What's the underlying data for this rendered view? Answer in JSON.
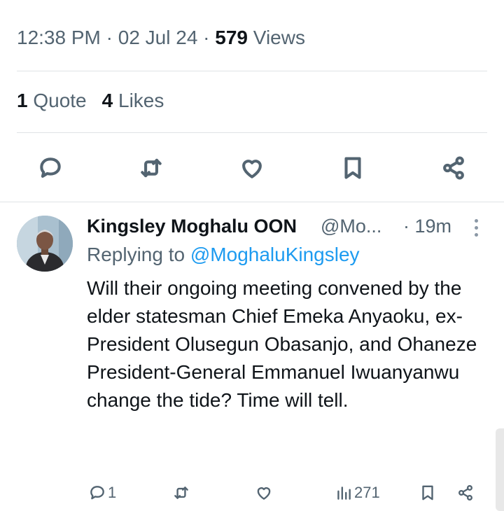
{
  "tweet_meta": {
    "time": "12:38 PM",
    "sep1": " · ",
    "date": "02 Jul 24",
    "sep2": " · ",
    "views_count": "579",
    "views_label": " Views"
  },
  "tweet_stats": {
    "quote_count": "1",
    "quote_label": " Quote",
    "likes_count": "4",
    "likes_label": " Likes"
  },
  "tweet_actions": {
    "icons": [
      "reply-icon",
      "retweet-icon",
      "like-icon",
      "bookmark-icon",
      "share-icon"
    ]
  },
  "reply": {
    "author_name": "Kingsley Moghalu OON",
    "author_handle": "@Mo...",
    "time": "· 19m",
    "replying_prefix": "Replying to ",
    "replying_to": "@MoghaluKingsley",
    "text": "Will their ongoing meeting convened by the elder statesman Chief Emeka Anyaoku, ex-President Olusegun Obasanjo, and Ohaneze President-General Emmanuel Iwuanyanwu change the tide? Time will tell.",
    "actions": {
      "reply_count": "1",
      "retweet_count": "",
      "like_count": "",
      "views_count": "271"
    }
  },
  "colors": {
    "text_primary": "#0f1419",
    "text_secondary": "#536471",
    "link": "#1d9bf0",
    "divider": "#dfe3e6"
  }
}
